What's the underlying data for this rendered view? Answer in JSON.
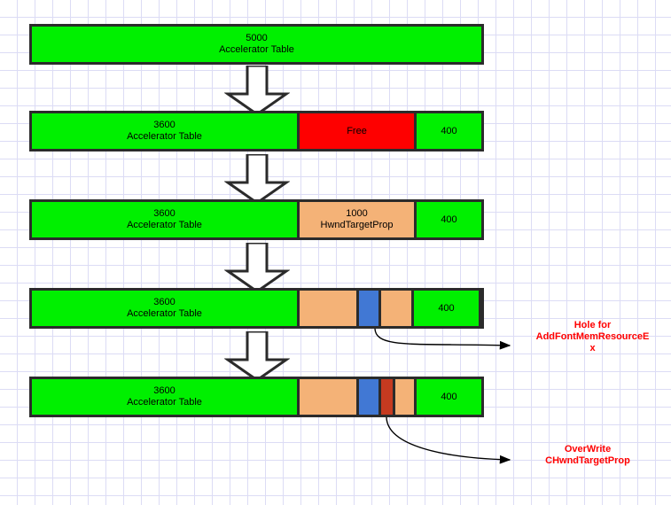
{
  "diagram": {
    "title": "Accelerator Table heap grooming layout",
    "background": {
      "grid_color": "#dcdcf5",
      "grid_size_px": 20,
      "page_color": "#ffffff"
    },
    "palette": {
      "green": "#00f000",
      "red": "#fe0000",
      "orange": "#f4b277",
      "blue": "#4178d4",
      "dark_red": "#c53a20",
      "outline": "#2b2b2b",
      "annotation": "#ff0000"
    },
    "rows": [
      {
        "id": "row-1",
        "segments": [
          {
            "id": "seg-accel-5000",
            "line1": "5000",
            "line2": "Accelerator Table",
            "color": "green"
          }
        ]
      },
      {
        "id": "row-2",
        "segments": [
          {
            "id": "seg-accel-3600",
            "line1": "3600",
            "line2": "Accelerator Table",
            "color": "green"
          },
          {
            "id": "seg-free",
            "line1": "Free",
            "line2": "",
            "color": "red"
          },
          {
            "id": "seg-400",
            "line1": "400",
            "line2": "",
            "color": "green"
          }
        ]
      },
      {
        "id": "row-3",
        "segments": [
          {
            "id": "seg-accel-3600",
            "line1": "3600",
            "line2": "Accelerator Table",
            "color": "green"
          },
          {
            "id": "seg-hwndtargetprop",
            "line1": "1000",
            "line2": "HwndTargetProp",
            "color": "orange"
          },
          {
            "id": "seg-400",
            "line1": "400",
            "line2": "",
            "color": "green"
          }
        ]
      },
      {
        "id": "row-4",
        "segments": [
          {
            "id": "seg-accel-3600",
            "line1": "3600",
            "line2": "Accelerator Table",
            "color": "green"
          },
          {
            "id": "seg-orange-left",
            "line1": "",
            "line2": "",
            "color": "orange"
          },
          {
            "id": "seg-blue-hole",
            "line1": "",
            "line2": "",
            "color": "blue"
          },
          {
            "id": "seg-orange-right",
            "line1": "",
            "line2": "",
            "color": "orange"
          },
          {
            "id": "seg-400",
            "line1": "400",
            "line2": "",
            "color": "green"
          }
        ]
      },
      {
        "id": "row-5",
        "segments": [
          {
            "id": "seg-accel-3600",
            "line1": "3600",
            "line2": "Accelerator Table",
            "color": "green"
          },
          {
            "id": "seg-orange-left",
            "line1": "",
            "line2": "",
            "color": "orange"
          },
          {
            "id": "seg-blue-hole",
            "line1": "",
            "line2": "",
            "color": "blue"
          },
          {
            "id": "seg-overwrite",
            "line1": "",
            "line2": "",
            "color": "dark_red"
          },
          {
            "id": "seg-orange-right",
            "line1": "",
            "line2": "",
            "color": "orange"
          },
          {
            "id": "seg-400",
            "line1": "400",
            "line2": "",
            "color": "green"
          }
        ]
      }
    ],
    "step_arrows": [
      {
        "id": "step-arrow-1",
        "icon": "down-block-arrow"
      },
      {
        "id": "step-arrow-2",
        "icon": "down-block-arrow"
      },
      {
        "id": "step-arrow-3",
        "icon": "down-block-arrow"
      },
      {
        "id": "step-arrow-4",
        "icon": "down-block-arrow"
      }
    ],
    "annotations": [
      {
        "id": "annotation-hole",
        "text": "Hole for\nAddFontMemResourceE\nx"
      },
      {
        "id": "annotation-overwrite",
        "text": "OverWrite\nCHwndTargetProp"
      }
    ]
  }
}
